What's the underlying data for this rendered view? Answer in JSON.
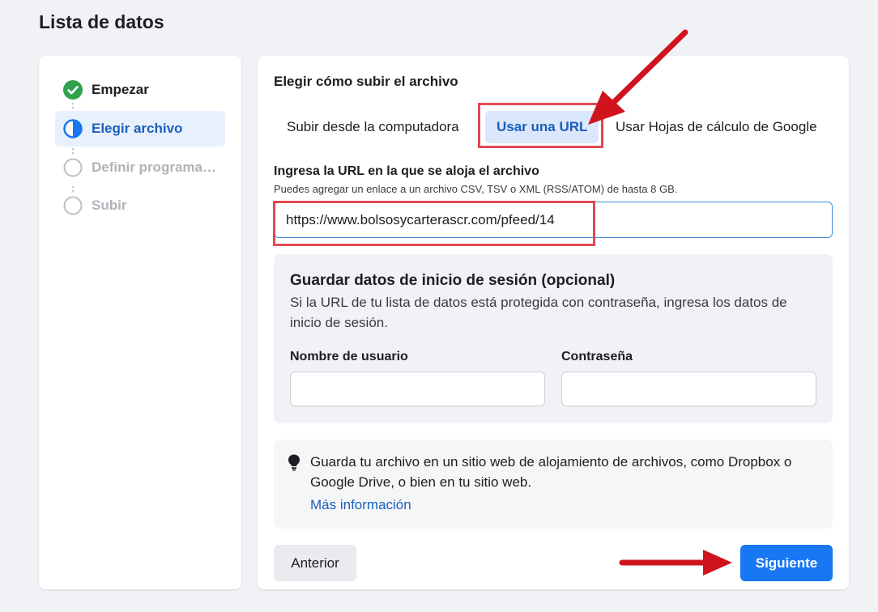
{
  "page": {
    "title": "Lista de datos"
  },
  "steps": [
    {
      "label": "Empezar",
      "state": "done"
    },
    {
      "label": "Elegir archivo",
      "state": "active"
    },
    {
      "label": "Definir programación",
      "state": "pending"
    },
    {
      "label": "Subir",
      "state": "pending"
    }
  ],
  "upload": {
    "title": "Elegir cómo subir el archivo",
    "tabs": [
      {
        "label": "Subir desde la computadora",
        "selected": false
      },
      {
        "label": "Usar una URL",
        "selected": true
      },
      {
        "label": "Usar Hojas de cálculo de Google",
        "selected": false
      }
    ]
  },
  "url_field": {
    "label": "Ingresa la URL en la que se aloja el archivo",
    "help": "Puedes agregar un enlace a un archivo CSV, TSV o XML (RSS/ATOM) de hasta 8 GB.",
    "value": "https://www.bolsosycarterascr.com/pfeed/14"
  },
  "login": {
    "title": "Guardar datos de inicio de sesión (opcional)",
    "description": "Si la URL de tu lista de datos está protegida con contraseña, ingresa los datos de inicio de sesión.",
    "username_label": "Nombre de usuario",
    "password_label": "Contraseña",
    "username_value": "",
    "password_value": ""
  },
  "tip": {
    "text": "Guarda tu archivo en un sitio web de alojamiento de archivos, como Dropbox o Google Drive, o bien en tu sitio web.",
    "link": "Más información"
  },
  "buttons": {
    "previous": "Anterior",
    "next": "Siguiente"
  },
  "colors": {
    "accent": "#1877f2",
    "active_text": "#1b5fb8",
    "success": "#31a24c",
    "annotation_red": "#d0141e"
  },
  "icons": {
    "step_done": "check-circle-icon",
    "step_active": "half-circle-icon",
    "step_pending": "empty-circle-icon",
    "tip": "lightbulb-icon"
  }
}
